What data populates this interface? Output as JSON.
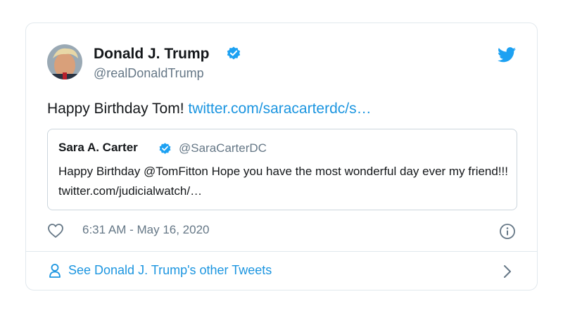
{
  "tweet": {
    "author_name": "Donald J. Trump",
    "author_handle": "@realDonaldTrump",
    "text": "Happy Birthday Tom! ",
    "link_text": "twitter.com/saracarterdc/s…",
    "timestamp": "6:31 AM - May 16, 2020",
    "avatar_icon": "avatar-photo",
    "brand_icon": "twitter-bird-icon"
  },
  "quote": {
    "author_name": "Sara A. Carter",
    "author_handle": "@SaraCarterDC",
    "text": "Happy Birthday @TomFitton Hope you have the most wonderful day ever my friend!!! twitter.com/judicialwatch/…"
  },
  "footer": {
    "link_label": "See Donald J. Trump's other Tweets"
  },
  "colors": {
    "accent": "#1b95e0",
    "verified": "#1da1f2",
    "secondary_text": "#657786",
    "border": "#e1e8ed"
  }
}
